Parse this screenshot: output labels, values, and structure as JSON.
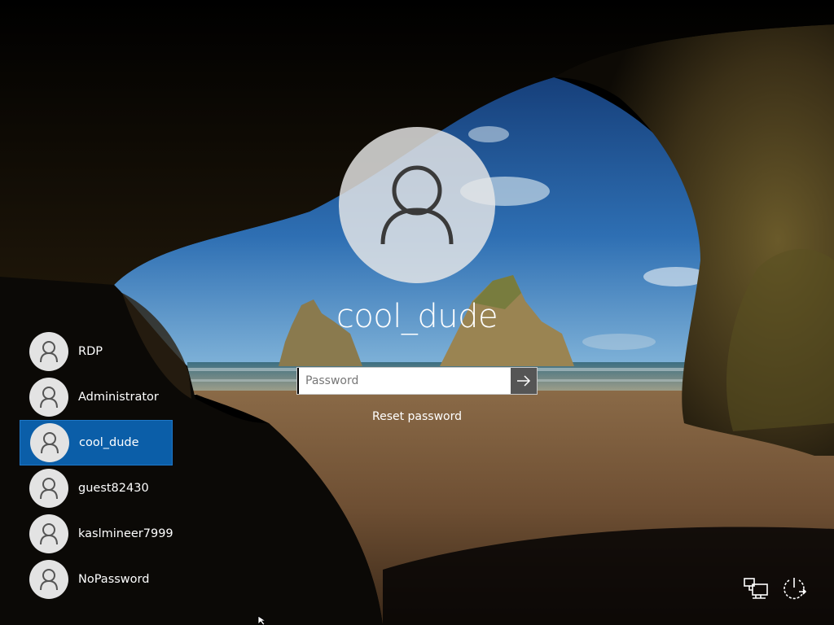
{
  "login": {
    "username": "cool_dude",
    "password_placeholder": "Password",
    "reset_label": "Reset password"
  },
  "users": [
    {
      "name": "RDP",
      "selected": false
    },
    {
      "name": "Administrator",
      "selected": false
    },
    {
      "name": "cool_dude",
      "selected": true
    },
    {
      "name": "guest82430",
      "selected": false
    },
    {
      "name": "kaslmineer7999",
      "selected": false
    },
    {
      "name": "NoPassword",
      "selected": false
    }
  ],
  "icons": {
    "avatar": "user-avatar-icon",
    "submit": "arrow-right-icon",
    "network": "network-icon",
    "power": "power-icon"
  },
  "colors": {
    "selected_user": "#0b5ea8",
    "submit_button": "#555555"
  }
}
